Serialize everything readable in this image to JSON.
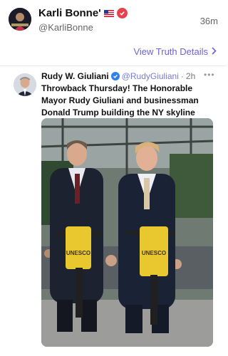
{
  "post": {
    "author_name": "Karli Bonne'",
    "author_handle": "@KarliBonne",
    "time": "36m",
    "view_link": "View Truth Details"
  },
  "quoted": {
    "author_name": "Rudy W. Giuliani",
    "author_handle": "@RudyGiuliani",
    "separator": "·",
    "time": "2h",
    "text_lines": [
      "Throwback Thursday! The Honorable",
      "Mayor Rudy Giuliani and businessman",
      "Donald Trump building the NY skyline"
    ],
    "photo": {
      "jackhammer_label_left": "UNESCO",
      "jackhammer_label_right": "UNESCO"
    }
  },
  "icons": {
    "verified": "verified-badge-icon",
    "flag": "us-flag-icon",
    "chevron": "chevron-right-icon",
    "more": "more-options-icon"
  },
  "colors": {
    "link": "#6c63d9",
    "verified_red": "#e8414e",
    "verified_blue": "#2f80ed"
  }
}
